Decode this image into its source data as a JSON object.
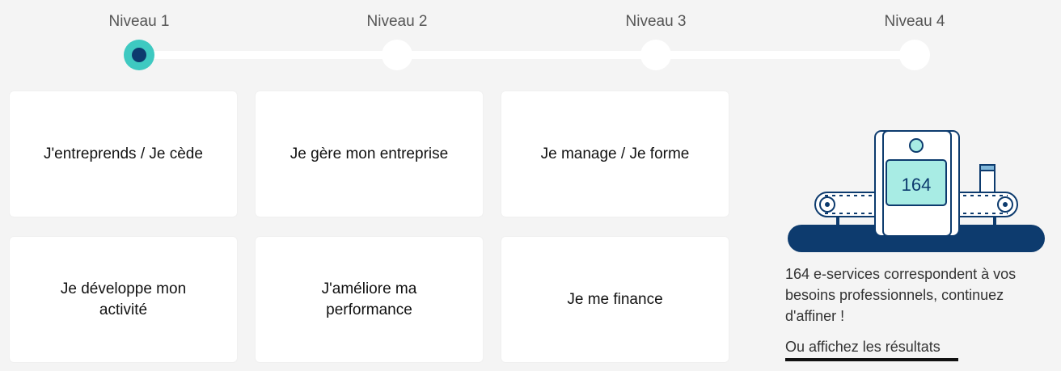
{
  "stepper": {
    "steps": [
      {
        "label": "Niveau 1",
        "active": true
      },
      {
        "label": "Niveau 2",
        "active": false
      },
      {
        "label": "Niveau 3",
        "active": false
      },
      {
        "label": "Niveau 4",
        "active": false
      }
    ]
  },
  "cards": [
    {
      "label": "J'entreprends / Je cède"
    },
    {
      "label": "Je gère mon entreprise"
    },
    {
      "label": "Je manage / Je forme"
    },
    {
      "label": "Je développe mon activité"
    },
    {
      "label": "J'améliore ma performance"
    },
    {
      "label": "Je me finance"
    }
  ],
  "counter": {
    "value": "164",
    "message": "164 e-services correspondent à vos besoins professionnels, continuez d'affiner !",
    "link": "Ou affichez les résultats"
  },
  "colors": {
    "background": "#f4f4f4",
    "accent": "#3ec9c1",
    "primary": "#0d3b6e",
    "screen": "#a8ece4"
  }
}
